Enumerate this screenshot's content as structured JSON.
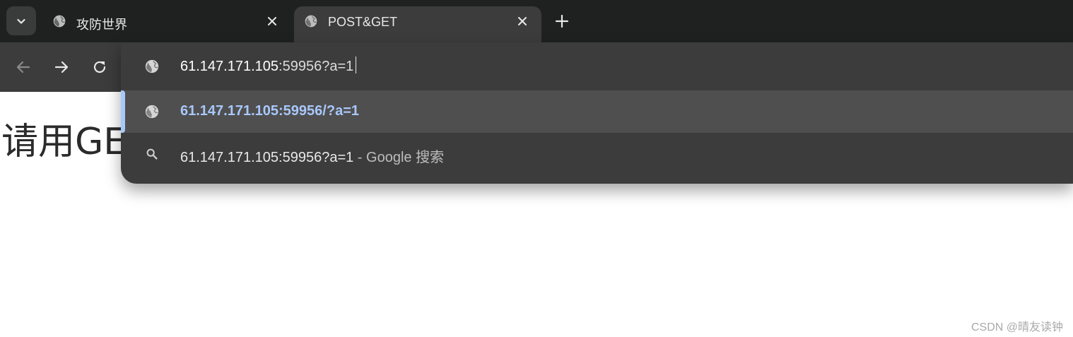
{
  "tabs": [
    {
      "title": "攻防世界",
      "icon": "globe-icon",
      "active": false
    },
    {
      "title": "POST&GET",
      "icon": "globe-icon",
      "active": true
    }
  ],
  "omnibox": {
    "input_host": "61.147.171.105",
    "input_rest": ":59956?a=1",
    "suggestions": [
      {
        "icon": "globe-icon",
        "text": "61.147.171.105:59956/?a=1",
        "selected": true
      },
      {
        "icon": "search-icon",
        "query": "61.147.171.105:59956?a=1",
        "suffix": " - Google 搜索"
      }
    ]
  },
  "page": {
    "heading": "请用GET"
  },
  "watermark": "CSDN @晴友读钟",
  "colors": {
    "tab_strip": "#1f2121",
    "toolbar": "#3c3c3c",
    "selected_row": "#4f4f4f",
    "accent_blue": "#a8c7fa"
  }
}
